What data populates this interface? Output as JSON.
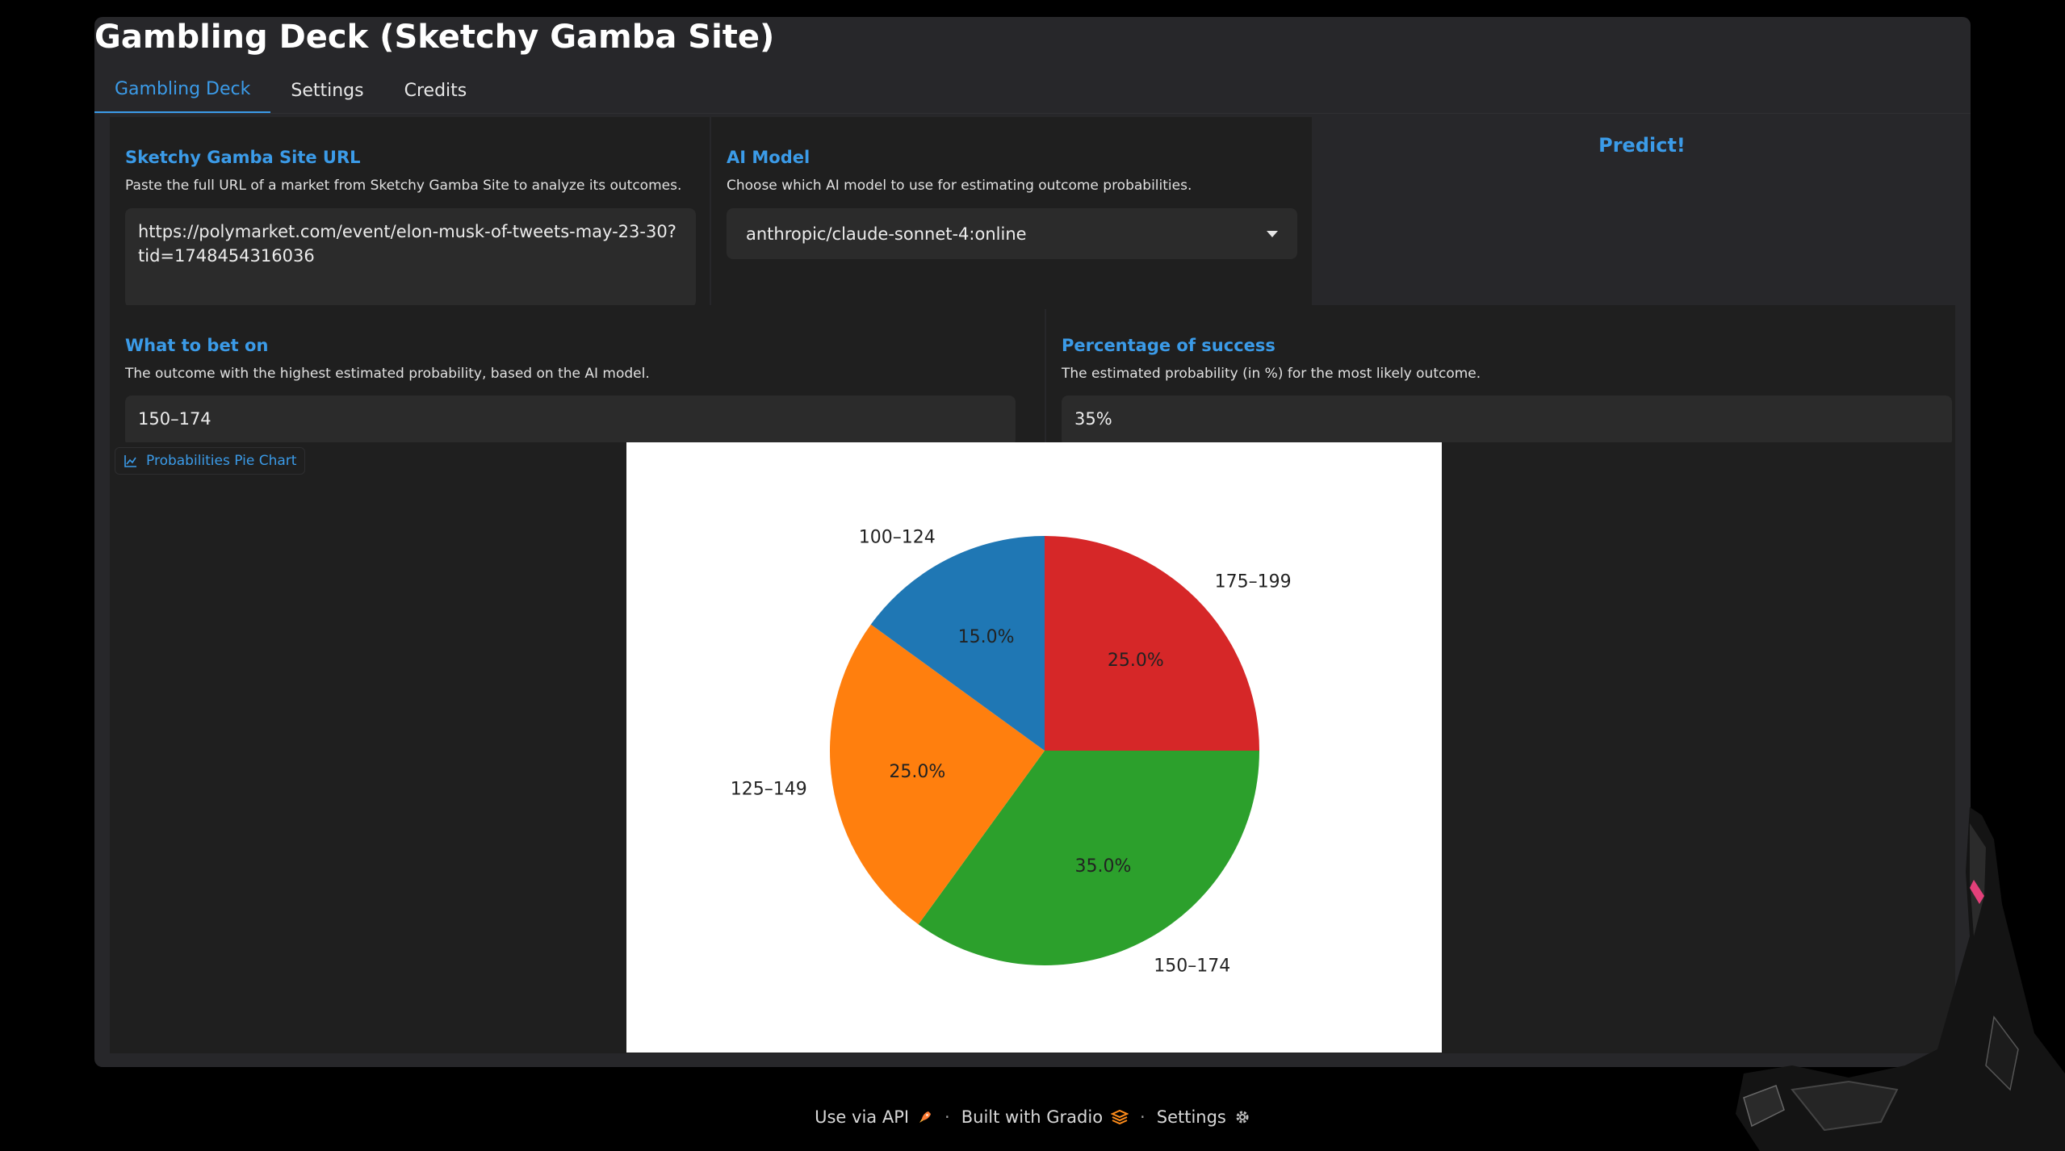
{
  "title": "Gambling Deck (Sketchy Gamba Site)",
  "tabs": [
    {
      "label": "Gambling Deck",
      "active": true
    },
    {
      "label": "Settings",
      "active": false
    },
    {
      "label": "Credits",
      "active": false
    }
  ],
  "url_input": {
    "label": "Sketchy Gamba Site URL",
    "info": "Paste the full URL of a market from Sketchy Gamba Site to analyze its outcomes.",
    "value": "https://polymarket.com/event/elon-musk-of-tweets-may-23-30?tid=1748454316036"
  },
  "model_select": {
    "label": "AI Model",
    "info": "Choose which AI model to use for estimating outcome probabilities.",
    "value": "anthropic/claude-sonnet-4:online"
  },
  "predict_button": {
    "label": "Predict!"
  },
  "bet_output": {
    "label": "What to bet on",
    "info": "The outcome with the highest estimated probability, based on the AI model.",
    "value": "150–174"
  },
  "success_output": {
    "label": "Percentage of success",
    "info": "The estimated probability (in %) for the most likely outcome.",
    "value": "35%"
  },
  "plot": {
    "label": "Probabilities Pie Chart"
  },
  "chart_data": {
    "type": "pie",
    "categories": [
      "175–199",
      "150–174",
      "125–149",
      "100–124"
    ],
    "values": [
      25.0,
      35.0,
      25.0,
      15.0
    ],
    "value_labels": [
      "25.0%",
      "35.0%",
      "25.0%",
      "15.0%"
    ],
    "colors": [
      "#d62728",
      "#2ca02c",
      "#ff7f0e",
      "#1f77b4"
    ]
  },
  "footer": {
    "api": "Use via API",
    "gradio": "Built with Gradio",
    "settings": "Settings",
    "separator": "·"
  },
  "colors": {
    "accent": "#3b9be8",
    "panel": "#1f1f1f",
    "container": "#27272a"
  }
}
